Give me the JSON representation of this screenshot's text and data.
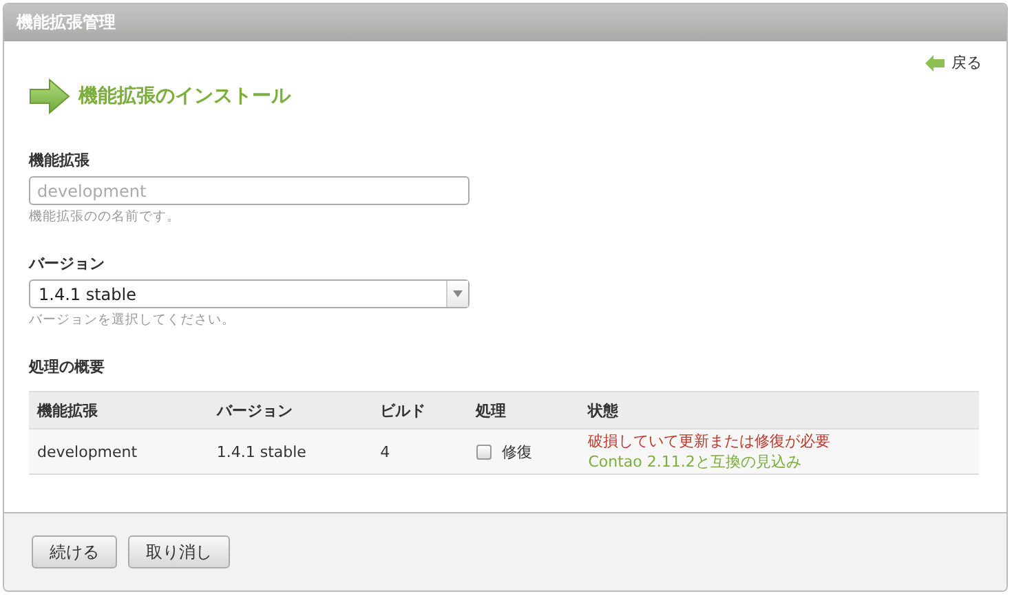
{
  "window": {
    "title": "機能拡張管理"
  },
  "back_link": {
    "label": "戻る"
  },
  "heading": "機能拡張のインストール",
  "fields": [
    {
      "kind": "text",
      "label": "機能拡張",
      "placeholder": "development",
      "hint": "機能拡張のの名前です。"
    },
    {
      "kind": "select",
      "label": "バージョン",
      "value": "1.4.1 stable",
      "hint": "バージョンを選択してください。"
    }
  ],
  "summary": {
    "title": "処理の概要",
    "columns": [
      "機能拡張",
      "バージョン",
      "ビルド",
      "処理",
      "状態"
    ],
    "rows": [
      {
        "extension": "development",
        "version": "1.4.1 stable",
        "build": "4",
        "action": {
          "label": "修復",
          "checked": false
        },
        "status": [
          {
            "kind": "error",
            "text": "破損していて更新または修復が必要"
          },
          {
            "kind": "ok",
            "text": "Contao 2.11.2と互換の見込み"
          }
        ]
      }
    ]
  },
  "buttons": [
    "続ける",
    "取り消し"
  ]
}
